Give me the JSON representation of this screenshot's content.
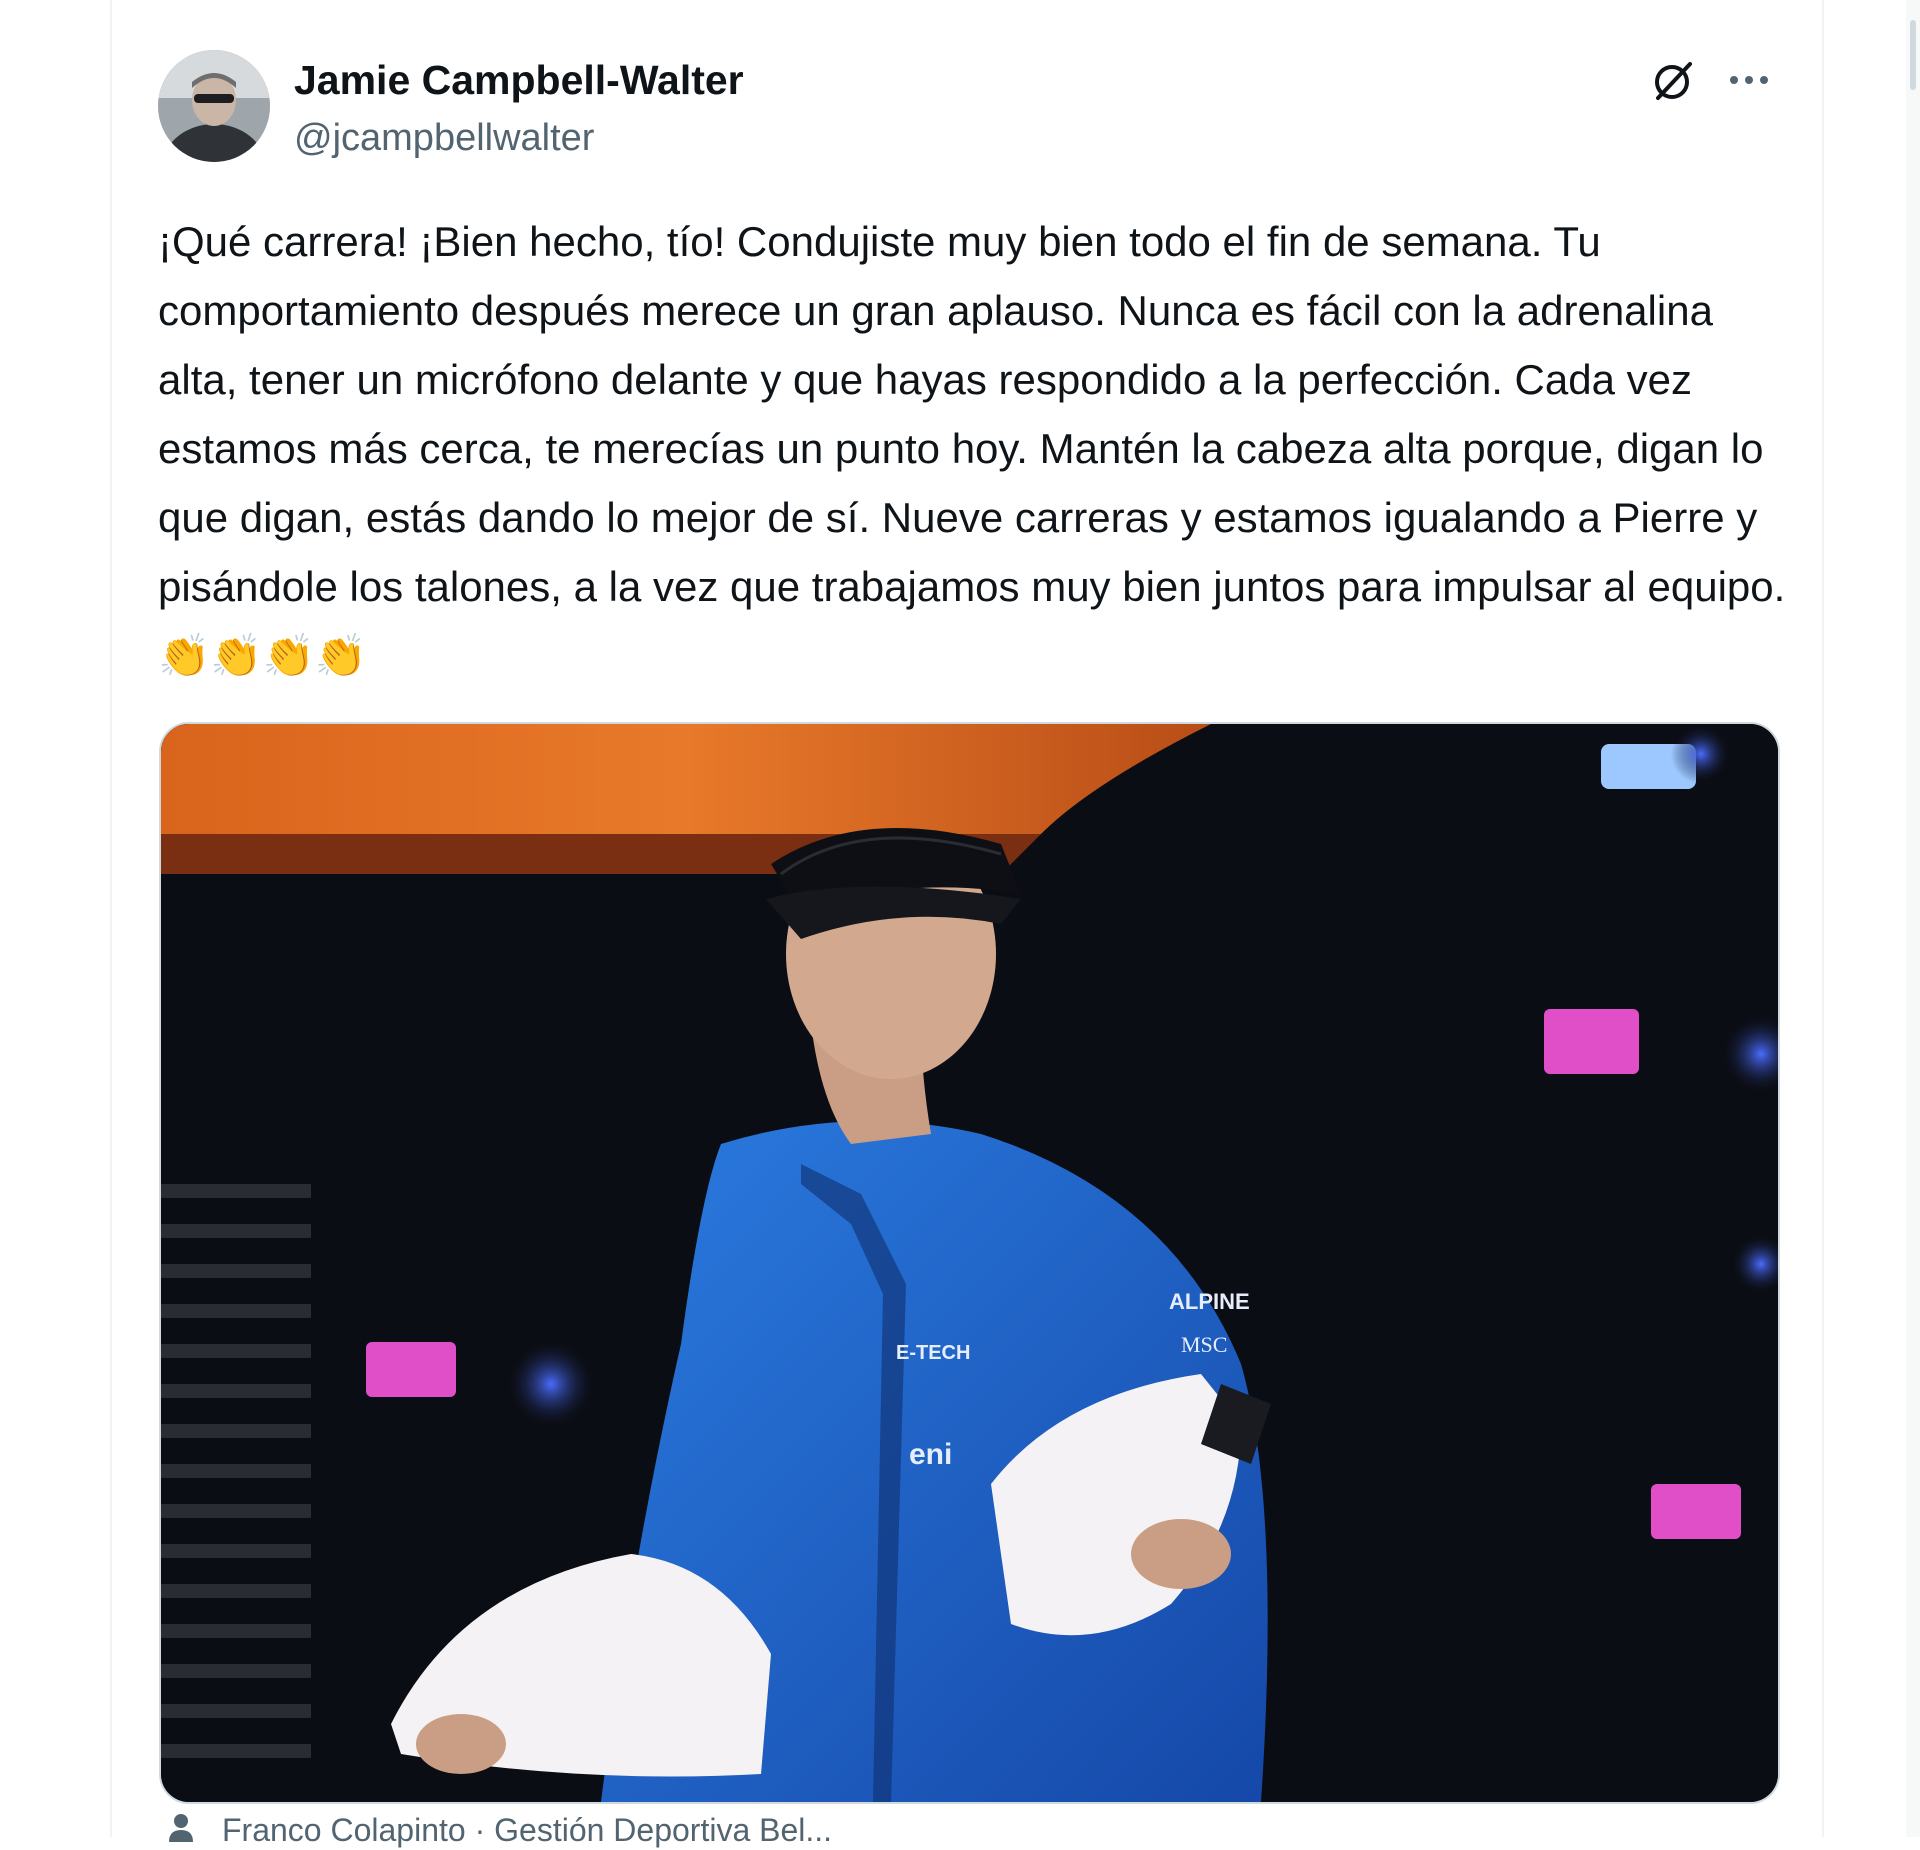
{
  "tweet": {
    "author": {
      "display_name": "Jamie Campbell-Walter",
      "handle": "@jcampbellwalter"
    },
    "header_icons": [
      "grok-icon",
      "more-icon"
    ],
    "text": "¡Qué carrera! ¡Bien hecho, tío! Condujiste muy bien todo el fin de semana. Tu comportamiento después merece un gran aplauso. Nunca es fácil con la adrenalina alta, tener un micrófono delante y que hayas respondido a la perfección. Cada vez estamos más cerca, te merecías un punto hoy. Mantén la cabeza alta porque, digan lo que digan, estás dando lo mejor de sí. Nueve carreras y estamos igualando a Pierre y pisándole los talones, a la vez que trabajamos muy bien juntos para impulsar al equipo.👏👏👏👏",
    "media": {
      "jacket_texts": [
        "ALPINE",
        "MSC",
        "E-TECH",
        "eni"
      ]
    },
    "tagged": {
      "text": "Franco Colapinto · Gestión Deportiva Bel..."
    }
  },
  "colors": {
    "text_primary": "#0f1419",
    "text_secondary": "#536471",
    "border": "#cfd9de",
    "jacket_blue": "#1f63c9"
  }
}
